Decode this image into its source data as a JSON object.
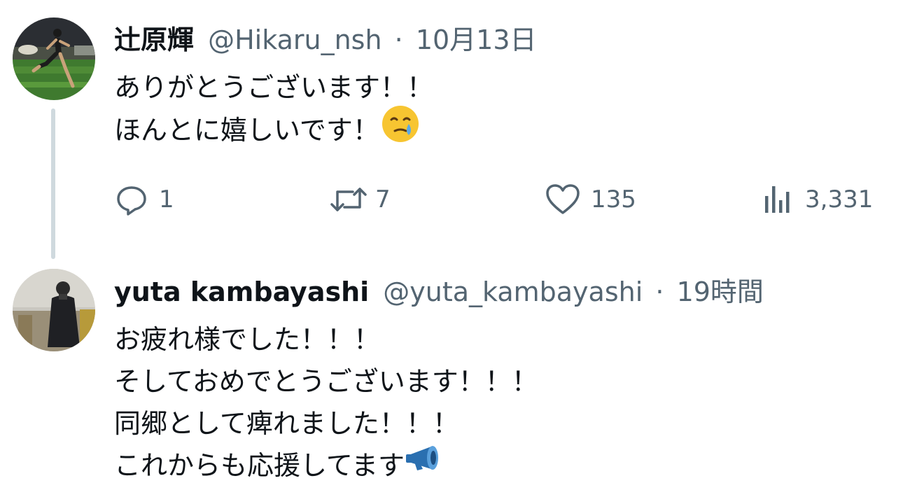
{
  "tweets": [
    {
      "name": "辻原輝",
      "handle": "@Hikaru_nsh",
      "separator": "·",
      "time": "10月13日",
      "lines": [
        "ありがとうございます！！",
        "ほんとに嬉しいです！"
      ],
      "line_emojis": [
        "",
        "face-holding-back-tears-emoji"
      ],
      "actions": {
        "reply_count": "1",
        "retweet_count": "7",
        "like_count": "135",
        "views_count": "3,331"
      },
      "avatar_icon": "runner-on-track-photo"
    },
    {
      "name": "yuta kambayashi",
      "handle": "@yuta_kambayashi",
      "separator": "·",
      "time": "19時間",
      "lines": [
        "お疲れ様でした！！！",
        "そしておめでとうございます！！！",
        "同郷として痺れました！！！",
        "これからも応援してます"
      ],
      "line_emojis": [
        "",
        "",
        "",
        "megaphone-emoji"
      ],
      "avatar_icon": "person-in-black-jacket-photo"
    }
  ],
  "colors": {
    "text_primary": "#0f1419",
    "text_secondary": "#536471",
    "thread_line": "#cfd9de",
    "emoji_yellow": "#f7c531",
    "tear_blue": "#5aa8e6",
    "megaphone_blue": "#2a6fb0"
  }
}
